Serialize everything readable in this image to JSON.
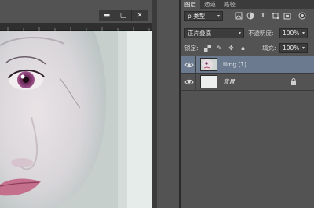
{
  "window_controls": {
    "minimize": "▬",
    "restore": "▢",
    "close": "✕"
  },
  "panel": {
    "tabs": [
      {
        "label": "图层"
      },
      {
        "label": "通道"
      },
      {
        "label": "路径"
      }
    ],
    "filter": {
      "label": "ρ 类型"
    },
    "blend": {
      "mode": "正片叠底",
      "opacity_label": "不透明度:",
      "opacity_value": "100%"
    },
    "lock": {
      "label": "锁定:",
      "fill_label": "填充:",
      "fill_value": "100%"
    },
    "layers": [
      {
        "name": "timg (1)",
        "selected": true
      },
      {
        "name": "背景",
        "selected": false
      }
    ]
  },
  "colors": {
    "selection": "#6b7a8f",
    "panel_bg": "#535353",
    "accent_lip": "#b85c7a"
  }
}
